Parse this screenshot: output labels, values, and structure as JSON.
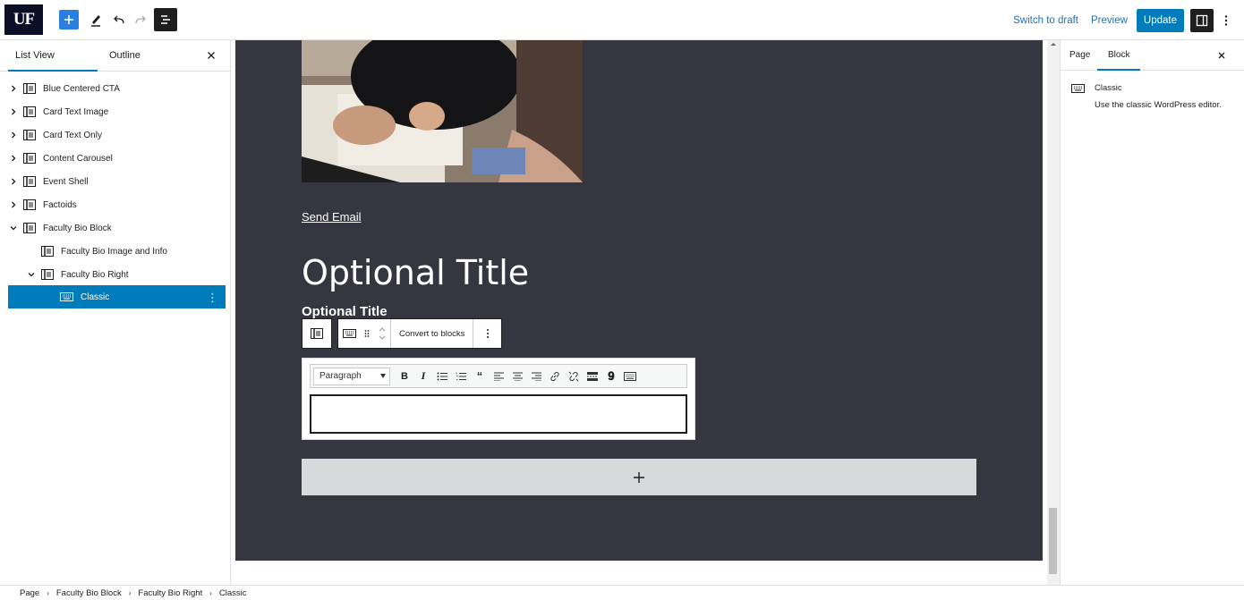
{
  "topbar": {
    "logo_text": "UF",
    "switch_to_draft": "Switch to draft",
    "preview": "Preview",
    "update": "Update"
  },
  "left_panel": {
    "tab_list_view": "List View",
    "tab_outline": "Outline",
    "tree": [
      {
        "label": "Blue Centered CTA",
        "expanded": false
      },
      {
        "label": "Card Text Image",
        "expanded": false
      },
      {
        "label": "Card Text Only",
        "expanded": false
      },
      {
        "label": "Content Carousel",
        "expanded": false
      },
      {
        "label": "Event Shell",
        "expanded": false
      },
      {
        "label": "Factoids",
        "expanded": false
      },
      {
        "label": "Faculty Bio Block",
        "expanded": true
      },
      {
        "label": "Faculty Bio Image and Info",
        "expanded": null
      },
      {
        "label": "Faculty Bio Right",
        "expanded": true
      },
      {
        "label": "Classic",
        "selected": true
      }
    ]
  },
  "canvas": {
    "send_email": "Send Email",
    "optional_title_large": "Optional Title",
    "optional_title_small": "Optional Title",
    "convert_to_blocks": "Convert to blocks",
    "paragraph_select": "Paragraph",
    "bg_color": "#363641"
  },
  "right_panel": {
    "tab_page": "Page",
    "tab_block": "Block",
    "block_name": "Classic",
    "block_description": "Use the classic WordPress editor."
  },
  "breadcrumb": [
    "Page",
    "Faculty Bio Block",
    "Faculty Bio Right",
    "Classic"
  ],
  "colors": {
    "accent": "#007cba",
    "canvas": "#363641"
  }
}
